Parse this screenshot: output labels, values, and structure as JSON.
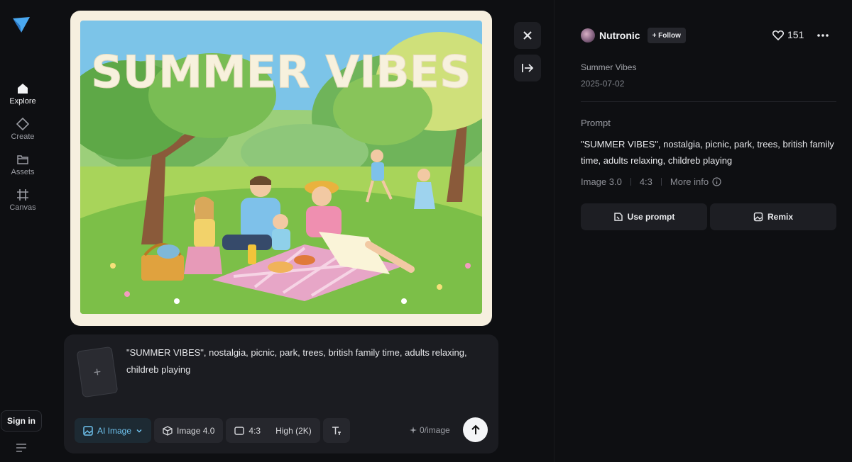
{
  "sidebar": {
    "items": [
      {
        "label": "Explore",
        "icon": "home-icon",
        "active": true
      },
      {
        "label": "Create",
        "icon": "diamond-icon",
        "active": false
      },
      {
        "label": "Assets",
        "icon": "folder-icon",
        "active": false
      },
      {
        "label": "Canvas",
        "icon": "grid-icon",
        "active": false
      }
    ],
    "sign_in": "Sign in"
  },
  "image": {
    "heading": "SUMMER VIBES"
  },
  "composer": {
    "prompt": "\"SUMMER VIBES\", nostalgia, picnic, park, trees, british family time, adults relaxing, childreb playing",
    "mode": "AI Image",
    "model": "Image 4.0",
    "ratio": "4:3",
    "quality": "High (2K)",
    "cost": "0/image"
  },
  "detail": {
    "author": "Nutronic",
    "follow": "+ Follow",
    "likes": "151",
    "title": "Summer Vibes",
    "date": "2025-07-02",
    "prompt_label": "Prompt",
    "prompt": "\"SUMMER VIBES\", nostalgia, picnic, park, trees, british family time, adults relaxing, childreb playing",
    "model": "Image 3.0",
    "ratio": "4:3",
    "more_info": "More info",
    "use_prompt": "Use prompt",
    "remix": "Remix"
  },
  "colors": {
    "background": "#0e0f12",
    "panel": "#1b1c21",
    "accent": "#6fc3ef"
  }
}
